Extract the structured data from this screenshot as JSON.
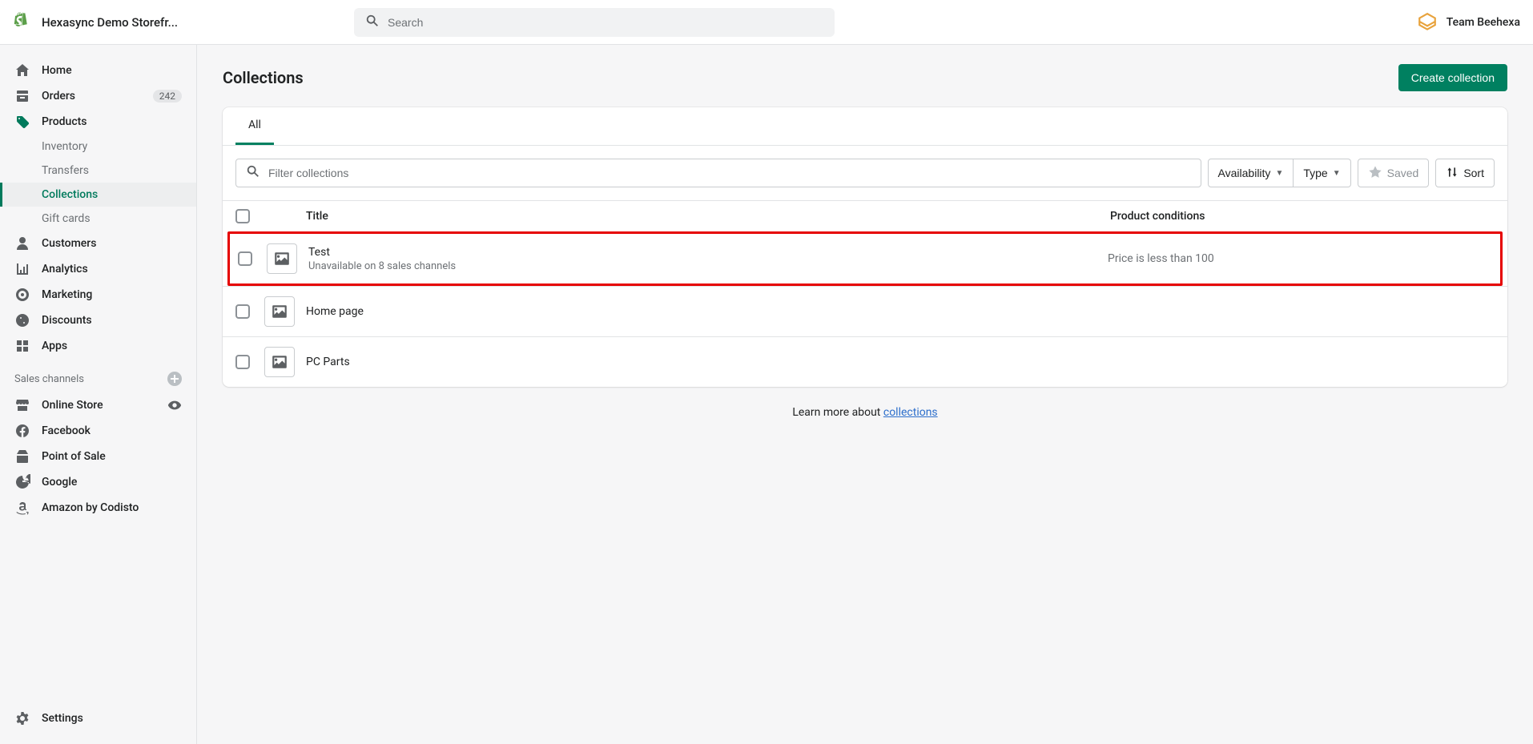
{
  "topbar": {
    "store_name": "Hexasync Demo Storefr...",
    "search_placeholder": "Search",
    "team_name": "Team Beehexa"
  },
  "sidebar": {
    "home": "Home",
    "orders": "Orders",
    "orders_badge": "242",
    "products": "Products",
    "inventory": "Inventory",
    "transfers": "Transfers",
    "collections": "Collections",
    "gift_cards": "Gift cards",
    "customers": "Customers",
    "analytics": "Analytics",
    "marketing": "Marketing",
    "discounts": "Discounts",
    "apps": "Apps",
    "sales_channels_label": "Sales channels",
    "online_store": "Online Store",
    "facebook": "Facebook",
    "point_of_sale": "Point of Sale",
    "google": "Google",
    "amazon": "Amazon by Codisto",
    "settings": "Settings"
  },
  "page": {
    "title": "Collections",
    "create_btn": "Create collection"
  },
  "tabs": {
    "all": "All"
  },
  "filters": {
    "filter_placeholder": "Filter collections",
    "availability": "Availability",
    "type": "Type",
    "saved": "Saved",
    "sort": "Sort"
  },
  "table": {
    "header_title": "Title",
    "header_conditions": "Product conditions",
    "rows": [
      {
        "title": "Test",
        "subtitle": "Unavailable on 8 sales channels",
        "conditions": "Price is less than 100",
        "highlight": true
      },
      {
        "title": "Home page",
        "subtitle": "",
        "conditions": "",
        "highlight": false
      },
      {
        "title": "PC Parts",
        "subtitle": "",
        "conditions": "",
        "highlight": false
      }
    ]
  },
  "footer": {
    "learn_prefix": "Learn more about ",
    "learn_link": "collections"
  }
}
